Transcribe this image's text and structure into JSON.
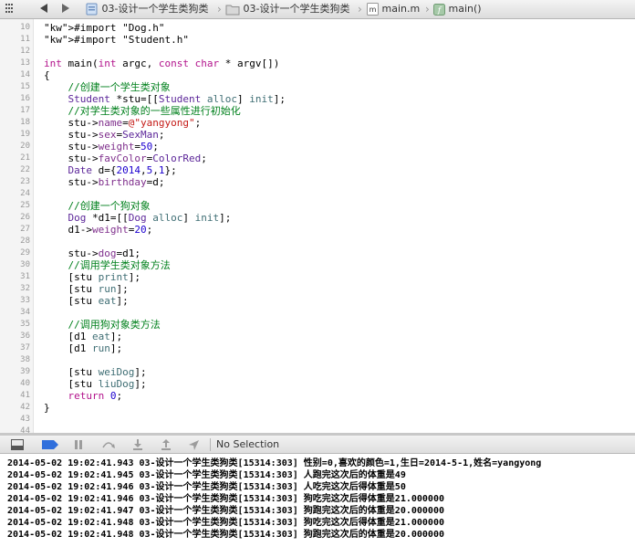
{
  "jump_bar": {
    "breadcrumbs": [
      {
        "label": "03-设计一个学生类狗类",
        "icon": "project-icon"
      },
      {
        "label": "03-设计一个学生类狗类",
        "icon": "folder-icon"
      },
      {
        "label": "main.m",
        "icon": "m-file-icon"
      },
      {
        "label": "main()",
        "icon": "function-icon"
      }
    ]
  },
  "editor": {
    "lines": [
      {
        "n": "10",
        "t": "#import \"Dog.h\""
      },
      {
        "n": "11",
        "t": "#import \"Student.h\""
      },
      {
        "n": "12",
        "t": ""
      },
      {
        "n": "13",
        "t": "int main(int argc, const char * argv[])"
      },
      {
        "n": "14",
        "t": "{"
      },
      {
        "n": "15",
        "t": "    //创建一个学生类对象"
      },
      {
        "n": "16",
        "t": "    Student *stu=[[Student alloc] init];"
      },
      {
        "n": "17",
        "t": "    //对学生类对象的一些属性进行初始化"
      },
      {
        "n": "18",
        "t": "    stu->name=@\"yangyong\";"
      },
      {
        "n": "19",
        "t": "    stu->sex=SexMan;"
      },
      {
        "n": "20",
        "t": "    stu->weight=50;"
      },
      {
        "n": "21",
        "t": "    stu->favColor=ColorRed;"
      },
      {
        "n": "22",
        "t": "    Date d={2014,5,1};"
      },
      {
        "n": "23",
        "t": "    stu->birthday=d;"
      },
      {
        "n": "24",
        "t": ""
      },
      {
        "n": "25",
        "t": "    //创建一个狗对象"
      },
      {
        "n": "26",
        "t": "    Dog *d1=[[Dog alloc] init];"
      },
      {
        "n": "27",
        "t": "    d1->weight=20;"
      },
      {
        "n": "28",
        "t": ""
      },
      {
        "n": "29",
        "t": "    stu->dog=d1;"
      },
      {
        "n": "30",
        "t": "    //调用学生类对象方法"
      },
      {
        "n": "31",
        "t": "    [stu print];"
      },
      {
        "n": "32",
        "t": "    [stu run];"
      },
      {
        "n": "33",
        "t": "    [stu eat];"
      },
      {
        "n": "34",
        "t": ""
      },
      {
        "n": "35",
        "t": "    //调用狗对象类方法"
      },
      {
        "n": "36",
        "t": "    [d1 eat];"
      },
      {
        "n": "37",
        "t": "    [d1 run];"
      },
      {
        "n": "38",
        "t": ""
      },
      {
        "n": "39",
        "t": "    [stu weiDog];"
      },
      {
        "n": "40",
        "t": "    [stu liuDog];"
      },
      {
        "n": "41",
        "t": "    return 0;"
      },
      {
        "n": "42",
        "t": "}"
      },
      {
        "n": "43",
        "t": ""
      },
      {
        "n": "44",
        "t": ""
      }
    ]
  },
  "debug_bar": {
    "selection_label": "No Selection"
  },
  "console": {
    "lines": [
      "2014-05-02 19:02:41.943 03-设计一个学生类狗类[15314:303] 性别=0,喜欢的颜色=1,生日=2014-5-1,姓名=yangyong",
      "2014-05-02 19:02:41.945 03-设计一个学生类狗类[15314:303] 人跑完这次后的体重是49",
      "2014-05-02 19:02:41.946 03-设计一个学生类狗类[15314:303] 人吃完这次后得体重是50",
      "2014-05-02 19:02:41.946 03-设计一个学生类狗类[15314:303] 狗吃完这次后得体重是21.000000",
      "2014-05-02 19:02:41.947 03-设计一个学生类狗类[15314:303] 狗跑完这次后的体重是20.000000",
      "2014-05-02 19:02:41.948 03-设计一个学生类狗类[15314:303] 狗吃完这次后得体重是21.000000",
      "2014-05-02 19:02:41.948 03-设计一个学生类狗类[15314:303] 狗跑完这次后的体重是20.000000"
    ]
  },
  "colors": {
    "keyword": "#b3148c",
    "string": "#c41a16",
    "comment": "#00801c",
    "number": "#1c00cf",
    "class": "#5c2699",
    "method": "#3f6e74",
    "property": "#7f2f8c",
    "accent": "#2f6fdc"
  }
}
